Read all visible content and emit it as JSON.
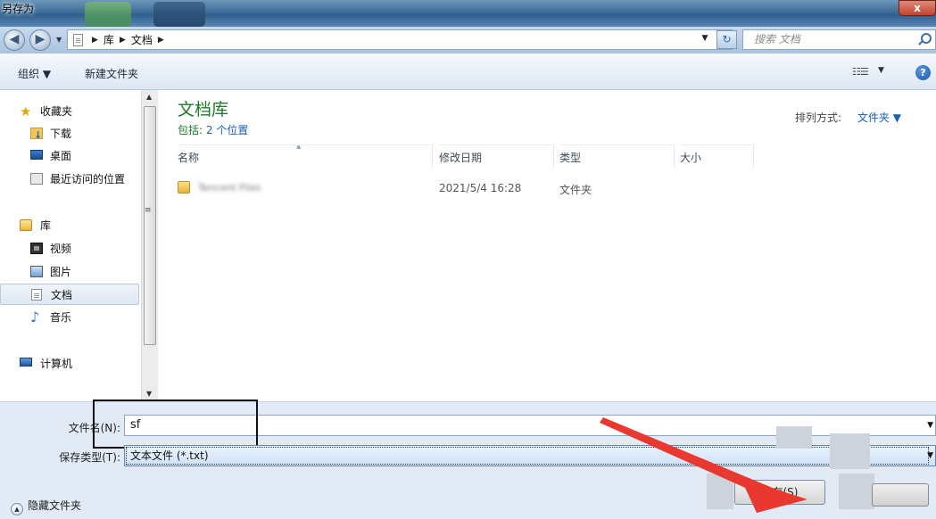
{
  "window": {
    "title": "另存为",
    "close_label": "x"
  },
  "address": {
    "crumbs": [
      "库",
      "文档"
    ],
    "search_placeholder": "搜索 文档"
  },
  "toolbar": {
    "organize": "组织 ▼",
    "new_folder": "新建文件夹"
  },
  "sidebar": {
    "favorites": {
      "label": "收藏夹",
      "items": [
        {
          "label": "下载",
          "icon": "download-icon"
        },
        {
          "label": "桌面",
          "icon": "desktop-icon"
        },
        {
          "label": "最近访问的位置",
          "icon": "recent-icon"
        }
      ]
    },
    "libraries": {
      "label": "库",
      "items": [
        {
          "label": "视频",
          "icon": "video-icon"
        },
        {
          "label": "图片",
          "icon": "picture-icon"
        },
        {
          "label": "文档",
          "icon": "document-icon",
          "selected": true
        },
        {
          "label": "音乐",
          "icon": "music-icon"
        }
      ]
    },
    "computer": {
      "label": "计算机"
    }
  },
  "main": {
    "library_title": "文档库",
    "includes_prefix": "包括:",
    "includes_link": "2 个位置",
    "arrange_label": "排列方式:",
    "arrange_value": "文件夹 ▼",
    "columns": [
      "名称",
      "修改日期",
      "类型",
      "大小"
    ],
    "files": [
      {
        "name": "Tencent Files",
        "modified": "2021/5/4 16:28",
        "type": "文件夹",
        "size": ""
      }
    ]
  },
  "form": {
    "filename_label": "文件名(N):",
    "filename_value": "sf",
    "filetype_label": "保存类型(T):",
    "filetype_value": "文本文件 (*.txt)",
    "hide_folders": "隐藏文件夹",
    "save_label": "保存(S)"
  },
  "colors": {
    "accent_green": "#1c7b2a",
    "link_blue": "#1a5fb4",
    "annotation_red": "#e8382f"
  }
}
